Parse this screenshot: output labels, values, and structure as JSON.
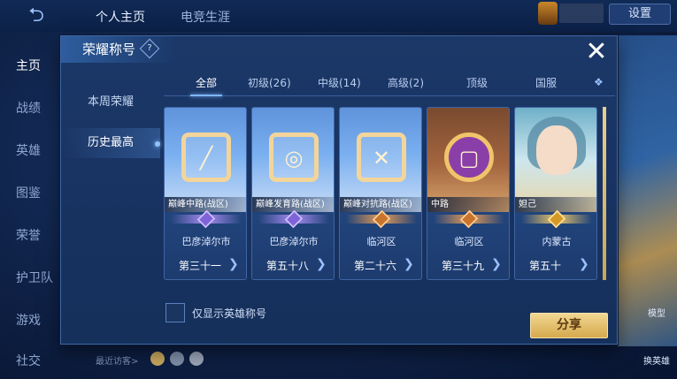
{
  "background": {
    "top_tabs": [
      "个人主页",
      "电竞生涯"
    ],
    "settings_label": "设置",
    "side_items": [
      "主页",
      "战绩",
      "英雄",
      "图鉴",
      "荣誉",
      "护卫队",
      "游戏",
      "社交"
    ],
    "visitor_label": "最近访客>",
    "right_buttons": [
      "模型",
      "换英雄"
    ]
  },
  "modal": {
    "title": "荣耀称号",
    "help_icon": "?",
    "close_icon": "✕",
    "left_nav": [
      "本周荣耀",
      "历史最高"
    ],
    "tabs": [
      "全部",
      "初级(26)",
      "中级(14)",
      "高级(2)",
      "顶级",
      "国服"
    ],
    "cards": [
      {
        "name": "巅峰中路(战区)",
        "region": "巴彦淖尔市",
        "rank": "第三十一",
        "badge": "purple",
        "glyph": "╱"
      },
      {
        "name": "巅峰发育路(战区)",
        "region": "巴彦淖尔市",
        "rank": "第五十八",
        "badge": "purple",
        "glyph": "◎"
      },
      {
        "name": "巅峰对抗路(战区)",
        "region": "临河区",
        "rank": "第二十六",
        "badge": "orange",
        "glyph": "✕"
      },
      {
        "name": "中路",
        "region": "临河区",
        "rank": "第三十九",
        "badge": "orange",
        "glyph": "▢"
      },
      {
        "name": "妲己",
        "region": "内蒙古",
        "rank": "第五十",
        "badge": "gold",
        "glyph": ""
      }
    ],
    "checkbox_label": "仅显示英雄称号",
    "share_label": "分享",
    "chevron": "❯"
  },
  "colors": {
    "accent": "#7fb6ff",
    "gold": "#d5a94d",
    "panel": "#183260"
  }
}
